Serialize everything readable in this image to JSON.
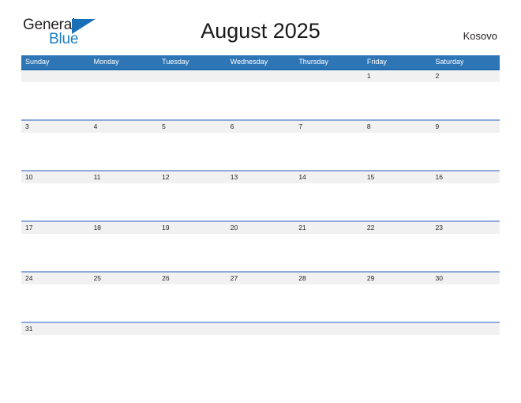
{
  "logo": {
    "word_one": "General",
    "word_two": "Blue",
    "triangle_color": "#1a70b8",
    "blue_text_color": "#1a7dc4"
  },
  "header": {
    "title": "August 2025",
    "country": "Kosovo"
  },
  "theme": {
    "header_blue": "#2e75b6",
    "first_row_border": "#1f6cb0",
    "row_border": "#8faadc",
    "day_band_gray": "#f1f1f1",
    "text_color": "#231f20"
  },
  "calendar": {
    "weekdays": [
      "Sunday",
      "Monday",
      "Tuesday",
      "Wednesday",
      "Thursday",
      "Friday",
      "Saturday"
    ],
    "weeks": [
      [
        "",
        "",
        "",
        "",
        "",
        "1",
        "2"
      ],
      [
        "3",
        "4",
        "5",
        "6",
        "7",
        "8",
        "9"
      ],
      [
        "10",
        "11",
        "12",
        "13",
        "14",
        "15",
        "16"
      ],
      [
        "17",
        "18",
        "19",
        "20",
        "21",
        "22",
        "23"
      ],
      [
        "24",
        "25",
        "26",
        "27",
        "28",
        "29",
        "30"
      ],
      [
        "31",
        "",
        "",
        "",
        "",
        "",
        ""
      ]
    ]
  }
}
